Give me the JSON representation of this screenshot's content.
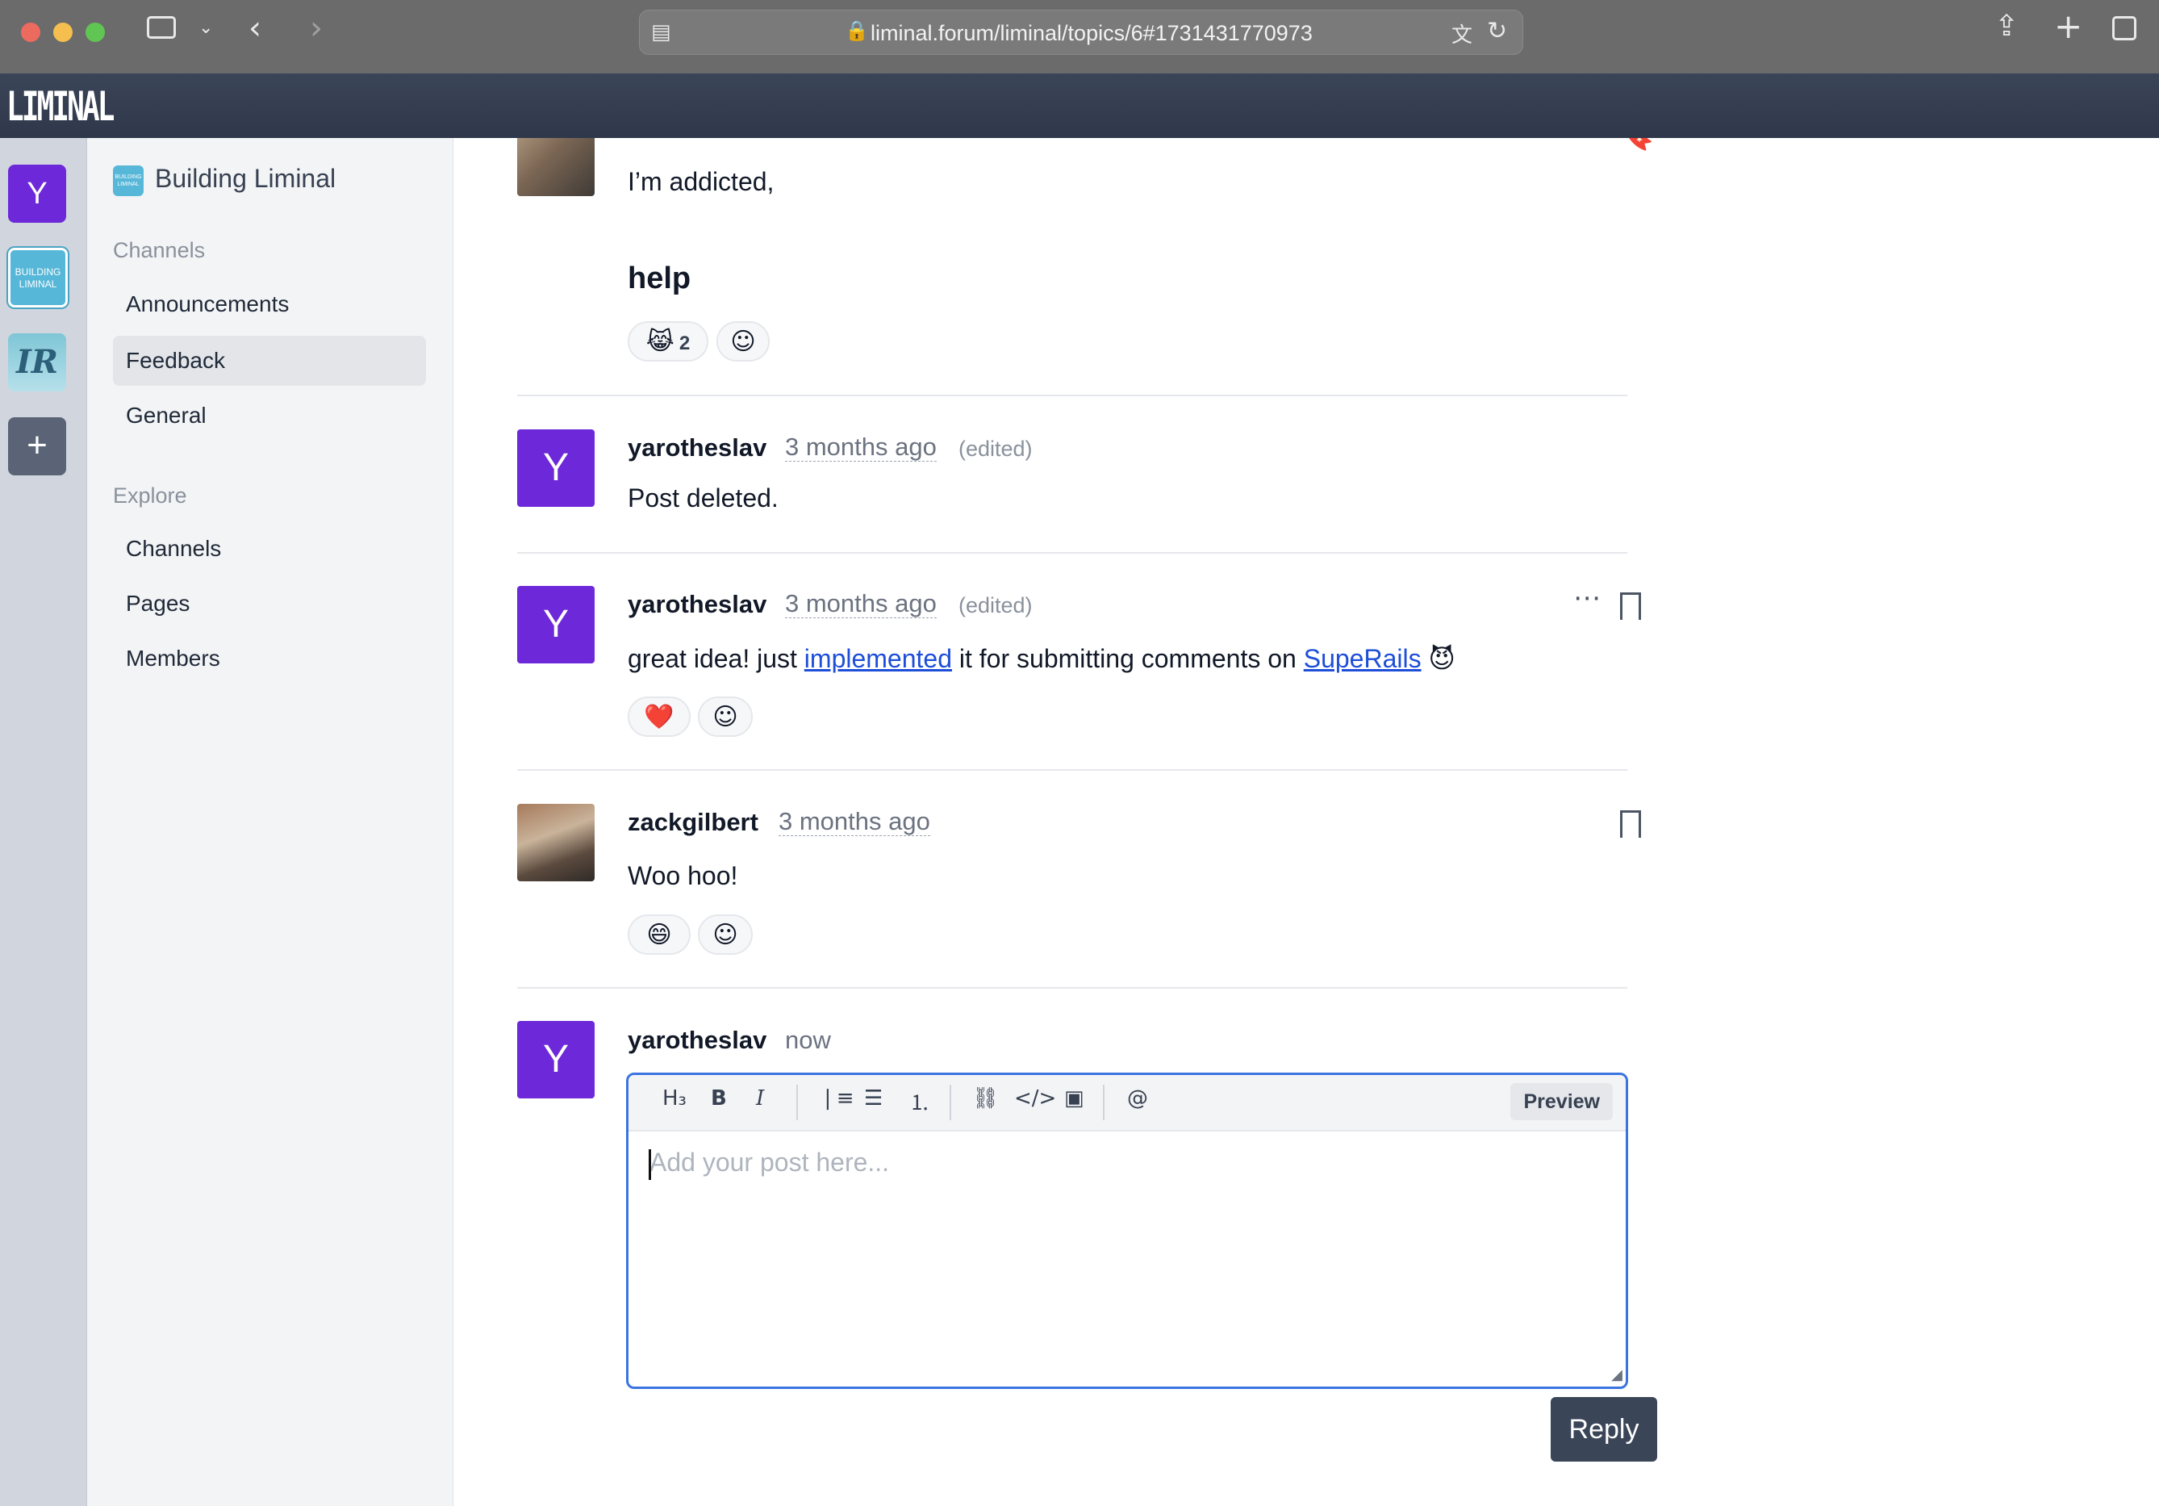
{
  "browser": {
    "url": "liminal.forum/liminal/topics/6#1731431770973"
  },
  "app": {
    "brand": "LIMINAL"
  },
  "rail": {
    "user_initial": "Y",
    "workspace_tile_text": "BUILDING LIMINAL",
    "ir_tile_text": "IR",
    "add_label": "+"
  },
  "sidebar": {
    "workspace_name": "Building Liminal",
    "workspace_logo_text": "BUILDING LIMINAL",
    "channels_heading": "Channels",
    "channels": [
      {
        "label": "Announcements"
      },
      {
        "label": "Feedback",
        "active": true
      },
      {
        "label": "General"
      }
    ],
    "explore_heading": "Explore",
    "explore": [
      {
        "label": "Channels"
      },
      {
        "label": "Pages"
      },
      {
        "label": "Members"
      }
    ]
  },
  "posts": [
    {
      "body_line1": "I’m addicted,",
      "body_heading": "help",
      "reactions": [
        {
          "emoji": "😹",
          "count": "2"
        }
      ],
      "add_reaction": "☺"
    },
    {
      "author": "yarotheslav",
      "avatar_initial": "Y",
      "time": "3 months ago",
      "edited": "(edited)",
      "body": "Post deleted."
    },
    {
      "author": "yarotheslav",
      "avatar_initial": "Y",
      "time": "3 months ago",
      "edited": "(edited)",
      "body_prefix": "great idea! just ",
      "link1": "implemented",
      "body_middle": " it for submitting comments on ",
      "link2": "SupeRails",
      "body_emoji": "😈",
      "reactions": [
        {
          "emoji": "❤️"
        }
      ],
      "add_reaction": "☺"
    },
    {
      "author": "zackgilbert",
      "time": "3 months ago",
      "body": "Woo hoo!",
      "reactions": [
        {
          "emoji": "😄"
        }
      ],
      "add_reaction": "☺"
    }
  ],
  "composer": {
    "author": "yarotheslav",
    "avatar_initial": "Y",
    "time": "now",
    "placeholder": "Add your post here...",
    "preview_label": "Preview",
    "reply_label": "Reply",
    "tools": [
      "H3",
      "B",
      "I",
      "quote",
      "bullet-list",
      "numbered-list",
      "link",
      "code",
      "image",
      "mention"
    ]
  },
  "colors": {
    "accent_purple": "#6d28d9",
    "header_dark": "#3b4558",
    "link_blue": "#1d4ed8",
    "editor_focus": "#3b74e0"
  }
}
